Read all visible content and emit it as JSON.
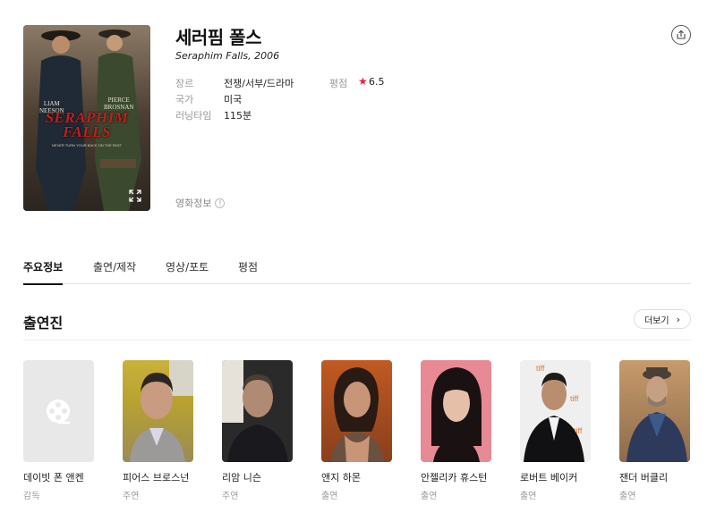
{
  "movie": {
    "title": "세러핌 폴스",
    "subtitle": "Seraphim Falls, 2006",
    "poster": {
      "top_name_left": "LIAM\nNEESON",
      "name_left_1": "LIAM",
      "name_left_2": "NEESON",
      "name_right_1": "PIERCE",
      "name_right_2": "BROSNAN",
      "title_line_1": "SERAPHIM",
      "title_line_2": "FALLS",
      "tagline": "NEVER TURN YOUR BACK ON THE PAST"
    },
    "meta": {
      "genre_label": "장르",
      "genre_value": "전쟁/서부/드라마",
      "rating_label": "평점",
      "rating_value": "6.5",
      "country_label": "국가",
      "country_value": "미국",
      "runtime_label": "러닝타임",
      "runtime_value": "115분"
    },
    "info_link": "영화정보",
    "info_link_icon": "!",
    "colors": {
      "star": "#e8243c"
    }
  },
  "tabs": [
    {
      "label": "주요정보"
    },
    {
      "label": "출연/제작"
    },
    {
      "label": "영상/포토"
    },
    {
      "label": "평점"
    }
  ],
  "cast_section": {
    "title": "출연진",
    "more_label": "더보기"
  },
  "cast": [
    {
      "name": "데이빗 폰 앤켄",
      "role": "감독",
      "photo": "placeholder-film-icon"
    },
    {
      "name": "피어스 브로스넌",
      "role": "주연",
      "photo": "portrait"
    },
    {
      "name": "리암 니슨",
      "role": "주연",
      "photo": "portrait"
    },
    {
      "name": "앤지 하몬",
      "role": "출연",
      "photo": "portrait"
    },
    {
      "name": "안젤리카 휴스턴",
      "role": "출연",
      "photo": "portrait"
    },
    {
      "name": "로버트 베이커",
      "role": "출연",
      "photo": "portrait"
    },
    {
      "name": "잰더 버클리",
      "role": "출연",
      "photo": "portrait"
    }
  ]
}
